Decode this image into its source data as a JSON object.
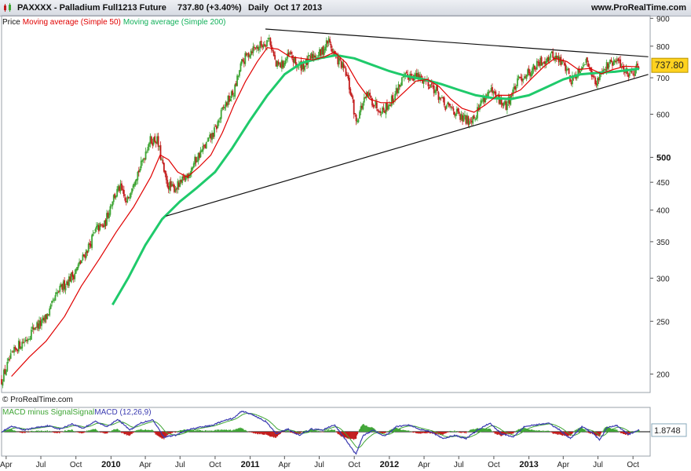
{
  "header": {
    "instrument": "PAXXXX - Palladium Full1213 Future",
    "price_change": "737.80 (+3.40%)",
    "period": "Daily",
    "date": "Oct 17 2013",
    "site": "www.ProRealTime.com"
  },
  "legend": {
    "price": "Price",
    "ma50": "Moving average (Simple 50)",
    "ma200": "Moving average (Simple 200)"
  },
  "credit": "© ProRealTime.com",
  "macd_legend": {
    "hist": "MACD minus Signal",
    "signal": "Signal",
    "macd": "MACD (12,26,9)"
  },
  "colors": {
    "up": "#3fa535",
    "down": "#c21b1b",
    "ma50": "#e00000",
    "ma200": "#1fca6b",
    "macd": "#3a3ab0",
    "price_tag": "#ffd21f"
  },
  "chart_data": [
    {
      "type": "candlestick",
      "title": "PAXXXX - Palladium Full1213 Future",
      "scale": "log",
      "ylim": [
        185,
        910
      ],
      "y_ticks": [
        {
          "v": 900,
          "label": "900",
          "bold": false
        },
        {
          "v": 800,
          "label": "800",
          "bold": false
        },
        {
          "v": 700,
          "label": "700",
          "bold": false
        },
        {
          "v": 600,
          "label": "600",
          "bold": false
        },
        {
          "v": 500,
          "label": "500",
          "bold": true
        },
        {
          "v": 450,
          "label": "450",
          "bold": false
        },
        {
          "v": 400,
          "label": "400",
          "bold": false
        },
        {
          "v": 350,
          "label": "350",
          "bold": false
        },
        {
          "v": 300,
          "label": "300",
          "bold": false
        },
        {
          "v": 250,
          "label": "250",
          "bold": false
        },
        {
          "v": 200,
          "label": "200",
          "bold": false
        }
      ],
      "xlim": [
        "2009-03-20",
        "2013-11-15"
      ],
      "x_ticks": [
        {
          "date": "2009-04-01",
          "label": "Apr",
          "bold": false
        },
        {
          "date": "2009-07-01",
          "label": "Jul",
          "bold": false
        },
        {
          "date": "2009-10-01",
          "label": "Oct",
          "bold": false
        },
        {
          "date": "2010-01-01",
          "label": "2010",
          "bold": true
        },
        {
          "date": "2010-04-01",
          "label": "Apr",
          "bold": false
        },
        {
          "date": "2010-07-01",
          "label": "Jul",
          "bold": false
        },
        {
          "date": "2010-10-01",
          "label": "Oct",
          "bold": false
        },
        {
          "date": "2011-01-01",
          "label": "2011",
          "bold": true
        },
        {
          "date": "2011-04-01",
          "label": "Apr",
          "bold": false
        },
        {
          "date": "2011-07-01",
          "label": "Jul",
          "bold": false
        },
        {
          "date": "2011-10-01",
          "label": "Oct",
          "bold": false
        },
        {
          "date": "2012-01-01",
          "label": "2012",
          "bold": true
        },
        {
          "date": "2012-04-01",
          "label": "Apr",
          "bold": false
        },
        {
          "date": "2012-07-01",
          "label": "Jul",
          "bold": false
        },
        {
          "date": "2012-10-01",
          "label": "Oct",
          "bold": false
        },
        {
          "date": "2013-01-01",
          "label": "2013",
          "bold": true
        },
        {
          "date": "2013-04-01",
          "label": "Apr",
          "bold": false
        },
        {
          "date": "2013-07-01",
          "label": "Jul",
          "bold": false
        },
        {
          "date": "2013-10-01",
          "label": "Oct",
          "bold": false
        }
      ],
      "last_price": 737.8,
      "last_price_label": "737.80",
      "price_path": [
        [
          "2009-03-20",
          195
        ],
        [
          "2009-04-10",
          212
        ],
        [
          "2009-05-01",
          225
        ],
        [
          "2009-05-25",
          232
        ],
        [
          "2009-06-15",
          245
        ],
        [
          "2009-07-05",
          248
        ],
        [
          "2009-07-25",
          262
        ],
        [
          "2009-08-15",
          282
        ],
        [
          "2009-09-05",
          295
        ],
        [
          "2009-09-25",
          305
        ],
        [
          "2009-10-15",
          322
        ],
        [
          "2009-11-05",
          345
        ],
        [
          "2009-11-25",
          370
        ],
        [
          "2009-12-15",
          375
        ],
        [
          "2010-01-05",
          420
        ],
        [
          "2010-01-25",
          440
        ],
        [
          "2010-02-10",
          410
        ],
        [
          "2010-03-01",
          455
        ],
        [
          "2010-03-20",
          480
        ],
        [
          "2010-04-10",
          535
        ],
        [
          "2010-05-01",
          540
        ],
        [
          "2010-05-25",
          450
        ],
        [
          "2010-06-10",
          438
        ],
        [
          "2010-07-01",
          445
        ],
        [
          "2010-07-25",
          470
        ],
        [
          "2010-08-15",
          500
        ],
        [
          "2010-09-10",
          530
        ],
        [
          "2010-10-01",
          560
        ],
        [
          "2010-10-25",
          620
        ],
        [
          "2010-11-20",
          660
        ],
        [
          "2010-12-10",
          745
        ],
        [
          "2011-01-05",
          790
        ],
        [
          "2011-02-01",
          805
        ],
        [
          "2011-02-20",
          828
        ],
        [
          "2011-03-10",
          735
        ],
        [
          "2011-03-25",
          740
        ],
        [
          "2011-04-15",
          770
        ],
        [
          "2011-05-05",
          735
        ],
        [
          "2011-05-25",
          740
        ],
        [
          "2011-06-15",
          770
        ],
        [
          "2011-07-05",
          775
        ],
        [
          "2011-07-25",
          820
        ],
        [
          "2011-08-10",
          770
        ],
        [
          "2011-08-25",
          745
        ],
        [
          "2011-09-10",
          710
        ],
        [
          "2011-09-25",
          640
        ],
        [
          "2011-10-05",
          580
        ],
        [
          "2011-10-20",
          620
        ],
        [
          "2011-11-05",
          650
        ],
        [
          "2011-11-25",
          625
        ],
        [
          "2011-12-15",
          610
        ],
        [
          "2012-01-10",
          640
        ],
        [
          "2012-02-01",
          690
        ],
        [
          "2012-02-25",
          710
        ],
        [
          "2012-03-20",
          700
        ],
        [
          "2012-04-10",
          690
        ],
        [
          "2012-05-01",
          665
        ],
        [
          "2012-05-25",
          620
        ],
        [
          "2012-06-15",
          615
        ],
        [
          "2012-07-05",
          590
        ],
        [
          "2012-07-25",
          585
        ],
        [
          "2012-08-15",
          600
        ],
        [
          "2012-09-01",
          640
        ],
        [
          "2012-09-20",
          660
        ],
        [
          "2012-10-10",
          640
        ],
        [
          "2012-11-01",
          620
        ],
        [
          "2012-11-20",
          660
        ],
        [
          "2012-12-10",
          700
        ],
        [
          "2013-01-05",
          720
        ],
        [
          "2013-01-25",
          740
        ],
        [
          "2013-02-15",
          760
        ],
        [
          "2013-03-05",
          770
        ],
        [
          "2013-03-25",
          750
        ],
        [
          "2013-04-10",
          730
        ],
        [
          "2013-04-20",
          690
        ],
        [
          "2013-05-10",
          720
        ],
        [
          "2013-05-25",
          750
        ],
        [
          "2013-06-10",
          740
        ],
        [
          "2013-06-25",
          675
        ],
        [
          "2013-07-10",
          725
        ],
        [
          "2013-07-25",
          735
        ],
        [
          "2013-08-10",
          745
        ],
        [
          "2013-08-25",
          750
        ],
        [
          "2013-09-10",
          720
        ],
        [
          "2013-09-25",
          715
        ],
        [
          "2013-10-05",
          725
        ],
        [
          "2013-10-17",
          738
        ]
      ],
      "series": [
        {
          "name": "Moving average (Simple 50)",
          "points": [
            [
              "2009-04-15",
              198
            ],
            [
              "2009-06-01",
              215
            ],
            [
              "2009-07-15",
              230
            ],
            [
              "2009-09-01",
              255
            ],
            [
              "2009-10-15",
              290
            ],
            [
              "2009-12-01",
              325
            ],
            [
              "2010-01-15",
              365
            ],
            [
              "2010-03-01",
              405
            ],
            [
              "2010-04-15",
              460
            ],
            [
              "2010-05-10",
              505
            ],
            [
              "2010-06-01",
              495
            ],
            [
              "2010-06-25",
              470
            ],
            [
              "2010-07-20",
              460
            ],
            [
              "2010-08-20",
              480
            ],
            [
              "2010-09-20",
              505
            ],
            [
              "2010-10-20",
              555
            ],
            [
              "2010-11-20",
              625
            ],
            [
              "2010-12-20",
              690
            ],
            [
              "2011-01-20",
              750
            ],
            [
              "2011-02-15",
              795
            ],
            [
              "2011-03-15",
              790
            ],
            [
              "2011-04-15",
              765
            ],
            [
              "2011-05-15",
              760
            ],
            [
              "2011-06-15",
              755
            ],
            [
              "2011-07-15",
              765
            ],
            [
              "2011-08-10",
              780
            ],
            [
              "2011-09-10",
              745
            ],
            [
              "2011-10-10",
              685
            ],
            [
              "2011-11-10",
              640
            ],
            [
              "2011-12-10",
              630
            ],
            [
              "2012-01-10",
              630
            ],
            [
              "2012-02-10",
              660
            ],
            [
              "2012-03-10",
              690
            ],
            [
              "2012-04-10",
              695
            ],
            [
              "2012-05-10",
              675
            ],
            [
              "2012-06-10",
              640
            ],
            [
              "2012-07-10",
              615
            ],
            [
              "2012-08-10",
              605
            ],
            [
              "2012-09-10",
              625
            ],
            [
              "2012-10-10",
              650
            ],
            [
              "2012-11-10",
              650
            ],
            [
              "2012-12-10",
              665
            ],
            [
              "2013-01-10",
              700
            ],
            [
              "2013-02-10",
              735
            ],
            [
              "2013-03-10",
              760
            ],
            [
              "2013-04-10",
              750
            ],
            [
              "2013-05-10",
              725
            ],
            [
              "2013-06-10",
              728
            ],
            [
              "2013-07-10",
              712
            ],
            [
              "2013-08-10",
              725
            ],
            [
              "2013-09-10",
              735
            ],
            [
              "2013-10-17",
              733
            ]
          ]
        },
        {
          "name": "Moving average (Simple 200)",
          "points": [
            [
              "2010-01-05",
              268
            ],
            [
              "2010-02-15",
              300
            ],
            [
              "2010-04-01",
              345
            ],
            [
              "2010-05-15",
              385
            ],
            [
              "2010-07-01",
              415
            ],
            [
              "2010-08-15",
              440
            ],
            [
              "2010-10-01",
              470
            ],
            [
              "2010-11-15",
              520
            ],
            [
              "2011-01-01",
              585
            ],
            [
              "2011-02-15",
              650
            ],
            [
              "2011-04-01",
              710
            ],
            [
              "2011-05-15",
              745
            ],
            [
              "2011-07-01",
              760
            ],
            [
              "2011-08-15",
              770
            ],
            [
              "2011-10-01",
              760
            ],
            [
              "2011-11-15",
              740
            ],
            [
              "2012-01-01",
              720
            ],
            [
              "2012-02-15",
              705
            ],
            [
              "2012-04-01",
              695
            ],
            [
              "2012-05-15",
              682
            ],
            [
              "2012-07-01",
              665
            ],
            [
              "2012-08-15",
              650
            ],
            [
              "2012-10-01",
              642
            ],
            [
              "2012-11-15",
              640
            ],
            [
              "2013-01-01",
              650
            ],
            [
              "2013-02-15",
              672
            ],
            [
              "2013-04-01",
              695
            ],
            [
              "2013-05-15",
              710
            ],
            [
              "2013-07-01",
              715
            ],
            [
              "2013-08-15",
              718
            ],
            [
              "2013-10-01",
              725
            ],
            [
              "2013-10-17",
              727
            ]
          ]
        }
      ],
      "annotations": [
        {
          "type": "trendline",
          "from": [
            "2011-02-10",
            860
          ],
          "to": [
            "2013-11-10",
            765
          ]
        },
        {
          "type": "trendline",
          "from": [
            "2010-05-25",
            390
          ],
          "to": [
            "2013-11-10",
            710
          ]
        }
      ]
    },
    {
      "type": "macd",
      "title": "MACD (12,26,9)",
      "ylim": [
        -28,
        28
      ],
      "last_value_label": "1.8748",
      "macd_path": [
        [
          "2009-03-20",
          0
        ],
        [
          "2009-04-15",
          6
        ],
        [
          "2009-05-20",
          2
        ],
        [
          "2009-06-20",
          5
        ],
        [
          "2009-07-20",
          7
        ],
        [
          "2009-08-20",
          3
        ],
        [
          "2009-09-20",
          9
        ],
        [
          "2009-10-20",
          4
        ],
        [
          "2009-11-20",
          12
        ],
        [
          "2009-12-20",
          6
        ],
        [
          "2010-01-20",
          14
        ],
        [
          "2010-02-20",
          2
        ],
        [
          "2010-03-20",
          10
        ],
        [
          "2010-04-20",
          14
        ],
        [
          "2010-05-20",
          -6
        ],
        [
          "2010-06-20",
          -4
        ],
        [
          "2010-07-20",
          2
        ],
        [
          "2010-08-20",
          5
        ],
        [
          "2010-09-20",
          7
        ],
        [
          "2010-10-20",
          12
        ],
        [
          "2010-11-20",
          16
        ],
        [
          "2010-12-10",
          24
        ],
        [
          "2011-01-10",
          19
        ],
        [
          "2011-02-10",
          12
        ],
        [
          "2011-03-10",
          -2
        ],
        [
          "2011-04-10",
          3
        ],
        [
          "2011-05-10",
          -4
        ],
        [
          "2011-06-10",
          3
        ],
        [
          "2011-07-10",
          2
        ],
        [
          "2011-08-10",
          8
        ],
        [
          "2011-09-10",
          -10
        ],
        [
          "2011-10-05",
          -26
        ],
        [
          "2011-10-25",
          -4
        ],
        [
          "2011-11-20",
          2
        ],
        [
          "2011-12-20",
          -5
        ],
        [
          "2012-01-20",
          6
        ],
        [
          "2012-02-20",
          8
        ],
        [
          "2012-03-20",
          3
        ],
        [
          "2012-04-20",
          0
        ],
        [
          "2012-05-20",
          -8
        ],
        [
          "2012-06-20",
          -4
        ],
        [
          "2012-07-20",
          -8
        ],
        [
          "2012-08-20",
          2
        ],
        [
          "2012-09-20",
          10
        ],
        [
          "2012-10-20",
          -2
        ],
        [
          "2012-11-20",
          -6
        ],
        [
          "2012-12-20",
          6
        ],
        [
          "2013-01-20",
          8
        ],
        [
          "2013-02-20",
          10
        ],
        [
          "2013-03-20",
          3
        ],
        [
          "2013-04-20",
          -8
        ],
        [
          "2013-05-20",
          6
        ],
        [
          "2013-06-20",
          -2
        ],
        [
          "2013-07-05",
          -10
        ],
        [
          "2013-07-25",
          5
        ],
        [
          "2013-08-20",
          7
        ],
        [
          "2013-09-20",
          -3
        ],
        [
          "2013-10-17",
          1.8748
        ]
      ]
    }
  ]
}
